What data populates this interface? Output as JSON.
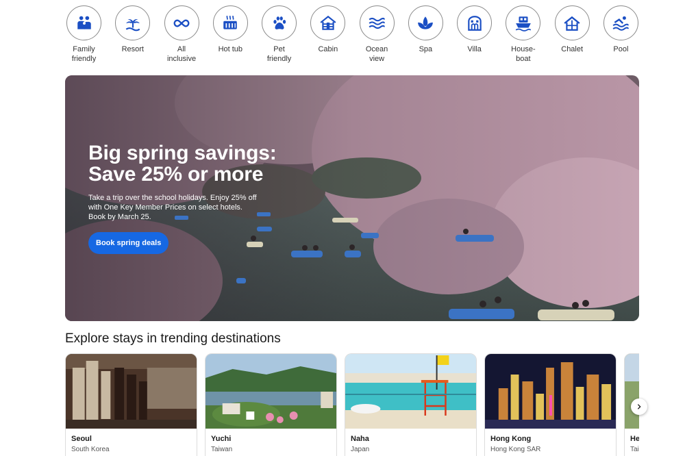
{
  "categories": [
    {
      "label": "Family\nfriendly",
      "icon": "family-icon"
    },
    {
      "label": "Resort",
      "icon": "palm-tree-icon"
    },
    {
      "label": "All\ninclusive",
      "icon": "infinity-icon"
    },
    {
      "label": "Hot tub",
      "icon": "hot-tub-icon"
    },
    {
      "label": "Pet\nfriendly",
      "icon": "paw-icon"
    },
    {
      "label": "Cabin",
      "icon": "cabin-icon"
    },
    {
      "label": "Ocean\nview",
      "icon": "waves-icon"
    },
    {
      "label": "Spa",
      "icon": "spa-lotus-icon"
    },
    {
      "label": "Villa",
      "icon": "villa-icon"
    },
    {
      "label": "House-\nboat",
      "icon": "houseboat-icon"
    },
    {
      "label": "Chalet",
      "icon": "chalet-icon"
    },
    {
      "label": "Pool",
      "icon": "pool-icon"
    }
  ],
  "hero": {
    "title": "Big spring savings:\nSave 25% or more",
    "text": "Take a trip over the school holidays. Enjoy 25% off\nwith One Key Member Prices on select hotels.\nBook by March 25.",
    "button": "Book spring deals"
  },
  "trending": {
    "heading": "Explore stays in trending destinations",
    "cards": [
      {
        "city": "Seoul",
        "country": "South Korea"
      },
      {
        "city": "Yuchi",
        "country": "Taiwan"
      },
      {
        "city": "Naha",
        "country": "Japan"
      },
      {
        "city": "Hong Kong",
        "country": "Hong Kong SAR"
      },
      {
        "city": "He",
        "country": "Tai"
      }
    ]
  },
  "colors": {
    "accent": "#1668e3",
    "icon_blue": "#1b4fc4"
  }
}
